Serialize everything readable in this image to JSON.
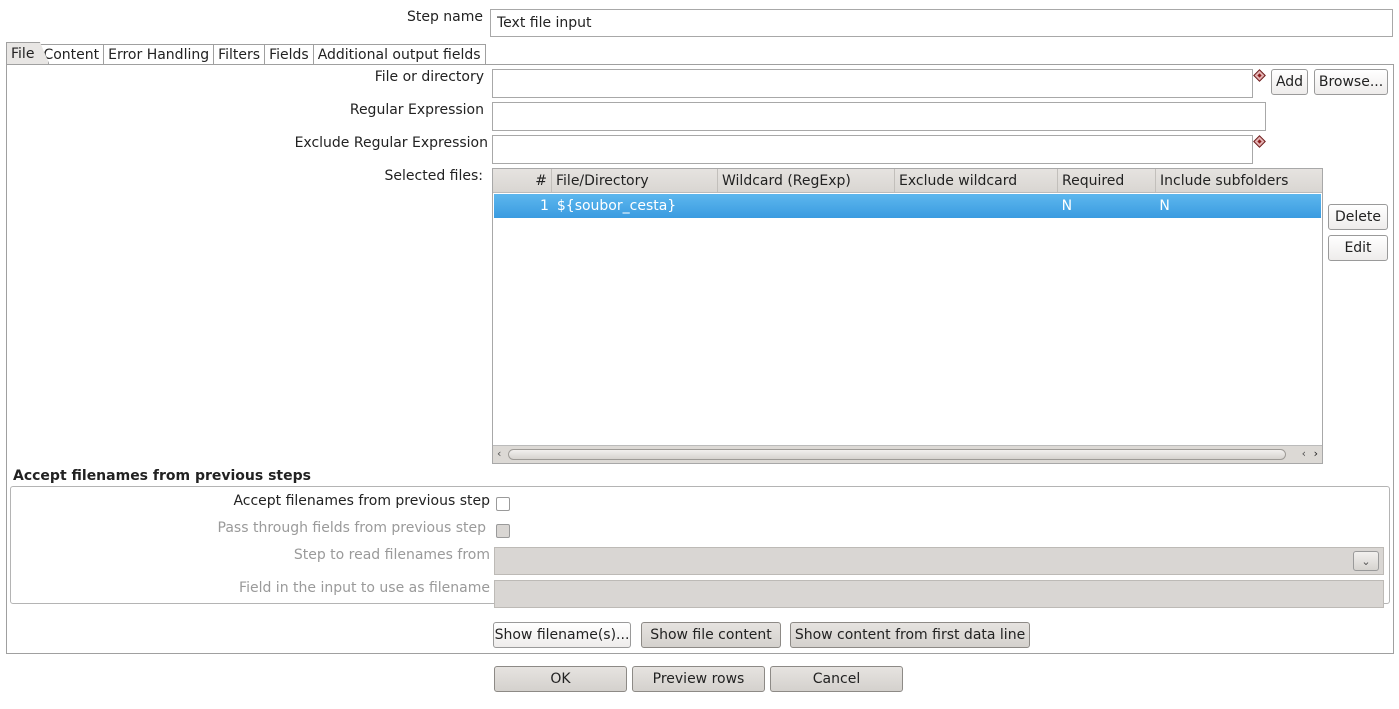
{
  "step_name": {
    "label": "Step name",
    "value": "Text file input"
  },
  "tabs": [
    {
      "label": "File"
    },
    {
      "label": "Content"
    },
    {
      "label": "Error Handling"
    },
    {
      "label": "Filters"
    },
    {
      "label": "Fields"
    },
    {
      "label": "Additional output fields"
    }
  ],
  "file": {
    "file_or_directory_label": "File or directory",
    "file_or_directory_value": "",
    "add_label": "Add",
    "browse_label": "Browse...",
    "regex_label": "Regular Expression",
    "regex_value": "",
    "exclude_regex_label": "Exclude Regular Expression",
    "exclude_regex_value": "",
    "selected_files_label": "Selected files:",
    "delete_label": "Delete",
    "edit_label": "Edit"
  },
  "table": {
    "columns": [
      "#",
      "File/Directory",
      "Wildcard (RegExp)",
      "Exclude wildcard",
      "Required",
      "Include subfolders"
    ],
    "rows": [
      {
        "num": "1",
        "file": "${soubor_cesta}",
        "wildcard": "",
        "exclude": "",
        "required": "N",
        "subfolders": "N"
      }
    ]
  },
  "previous_steps": {
    "title": "Accept filenames from previous steps",
    "accept_label": "Accept filenames from previous step",
    "pass_through_label": "Pass through fields from previous step",
    "step_label": "Step to read filenames from",
    "field_label": "Field in the input to use as filename",
    "step_value": "",
    "field_value": ""
  },
  "show_buttons": {
    "show_filenames": "Show filename(s)...",
    "show_file_content": "Show file content",
    "show_content_first_line": "Show content from first data line"
  },
  "footer": {
    "ok": "OK",
    "preview": "Preview rows",
    "cancel": "Cancel"
  }
}
